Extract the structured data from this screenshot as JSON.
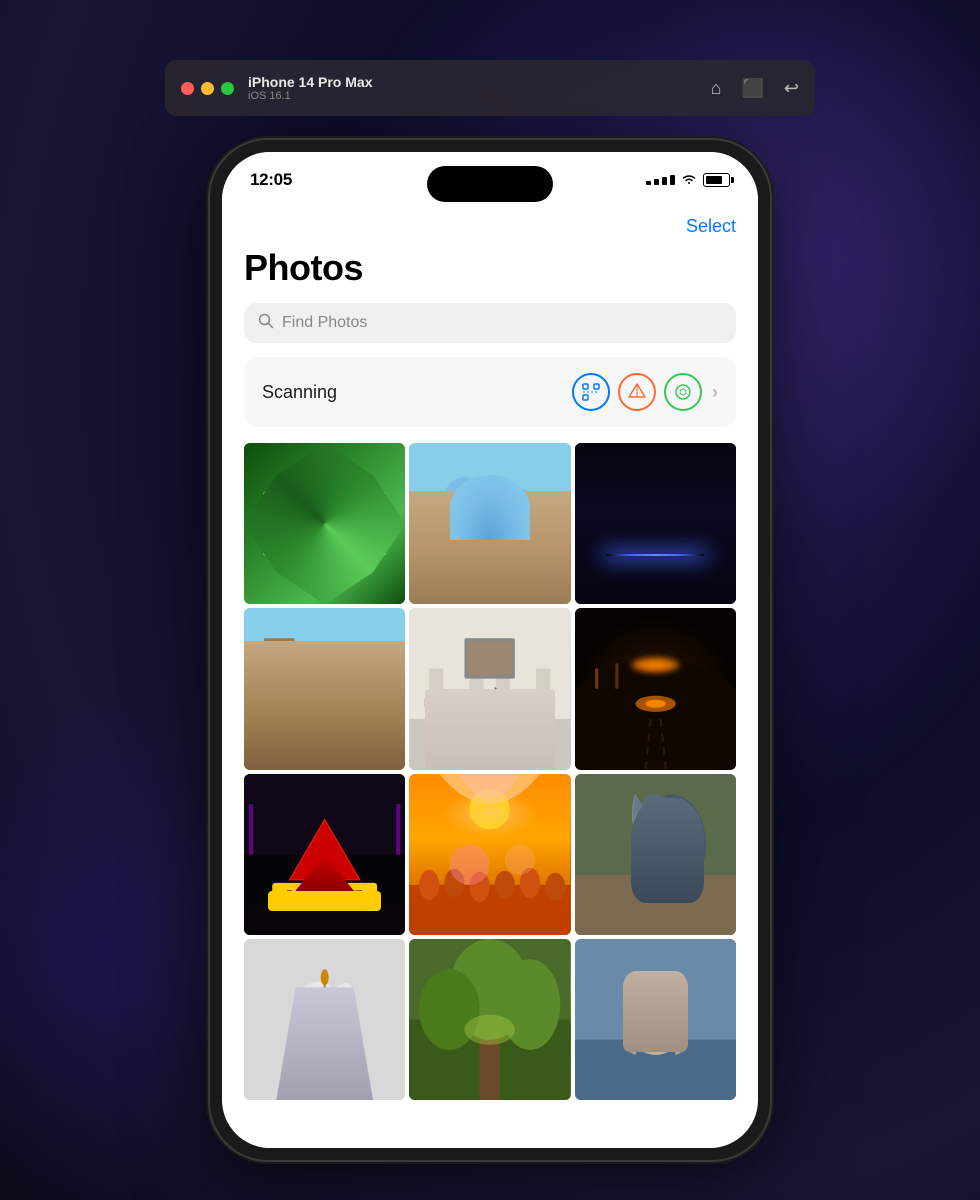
{
  "background": {
    "color": "#1a1a3e"
  },
  "titlebar": {
    "device_name": "iPhone 14 Pro Max",
    "os_version": "iOS 16.1",
    "traffic_lights": {
      "red": "#ff5f57",
      "yellow": "#febc2e",
      "green": "#28c840"
    },
    "actions": {
      "home": "⌂",
      "screenshot": "📷",
      "rotate": "↩"
    }
  },
  "status_bar": {
    "time": "12:05",
    "signal": "····",
    "wifi": "wifi",
    "battery": "battery"
  },
  "header": {
    "select_label": "Select",
    "title": "Photos"
  },
  "search": {
    "placeholder": "Find Photos"
  },
  "scanning_card": {
    "label": "Scanning",
    "icon1": "scan",
    "icon2": "cube",
    "icon3": "circle",
    "chevron": "›"
  },
  "photos": {
    "grid_rows": [
      [
        "green-geometric",
        "mosque-blue-domes",
        "bridge-night"
      ],
      [
        "ancient-temple",
        "museum-interior",
        "dark-tunnel"
      ],
      [
        "neon-concert",
        "orange-festival",
        "horse-close"
      ],
      [
        "white-flower",
        "forest-path",
        "eagle-bird"
      ]
    ]
  }
}
